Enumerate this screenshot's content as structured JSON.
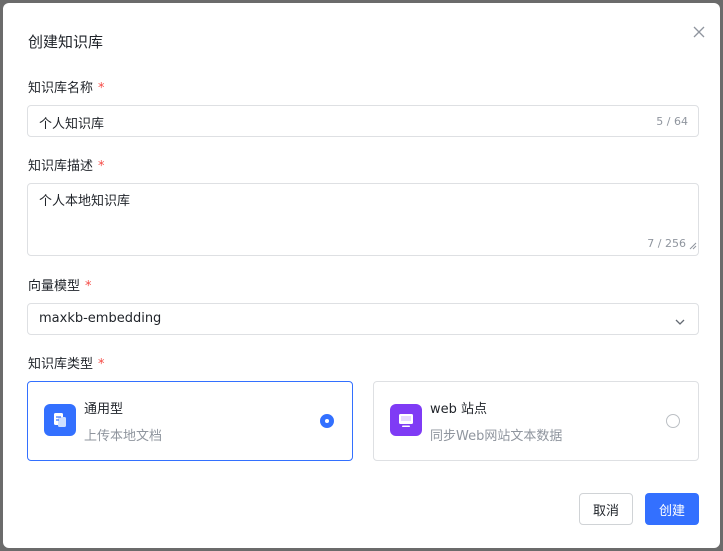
{
  "dialog": {
    "title": "创建知识库"
  },
  "fields": {
    "name": {
      "label": "知识库名称",
      "required_mark": "*",
      "value": "个人知识库",
      "counter": "5 / 64"
    },
    "description": {
      "label": "知识库描述",
      "required_mark": "*",
      "value": "个人本地知识库",
      "counter": "7 / 256"
    },
    "embedding_model": {
      "label": "向量模型",
      "required_mark": "*",
      "selected": "maxkb-embedding"
    },
    "kb_type": {
      "label": "知识库类型",
      "required_mark": "*",
      "options": [
        {
          "title": "通用型",
          "description": "上传本地文档",
          "icon": "document-icon",
          "icon_color": "#3370ff",
          "selected": true
        },
        {
          "title": "web 站点",
          "description": "同步Web网站文本数据",
          "icon": "monitor-icon",
          "icon_color": "#7f3bf5",
          "selected": false
        }
      ]
    }
  },
  "buttons": {
    "cancel": "取消",
    "create": "创建"
  },
  "colors": {
    "primary": "#3370ff",
    "required": "#f54a45",
    "web_icon": "#7f3bf5"
  }
}
